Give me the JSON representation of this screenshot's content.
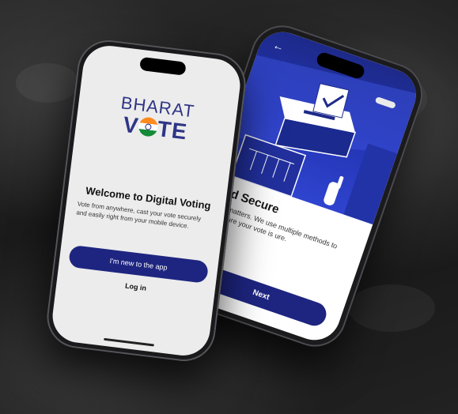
{
  "phone_front": {
    "logo_top": "BHARAT",
    "logo_v": "V",
    "logo_o": "",
    "logo_te": "TE",
    "title": "Welcome to Digital Voting",
    "description": "Vote from anywhere, cast your vote securely and easily right from your mobile device.",
    "primary_button": "I'm new to the app",
    "secondary_button": "Log in"
  },
  "phone_back": {
    "back_glyph": "←",
    "title": "nd Secure",
    "description": "ity matters. We use multiple methods to ensure your vote is ure.",
    "next_button": "Next"
  },
  "colors": {
    "brand_navy": "#1e2580",
    "logo_text": "#2f3586",
    "illustration_blue": "#2435b6",
    "saffron": "#ff8a1f",
    "green": "#138a36"
  },
  "icons": [
    "back-arrow-icon",
    "ballot-box-icon",
    "checkmark-icon",
    "polling-booth-icon",
    "hand-icon"
  ]
}
